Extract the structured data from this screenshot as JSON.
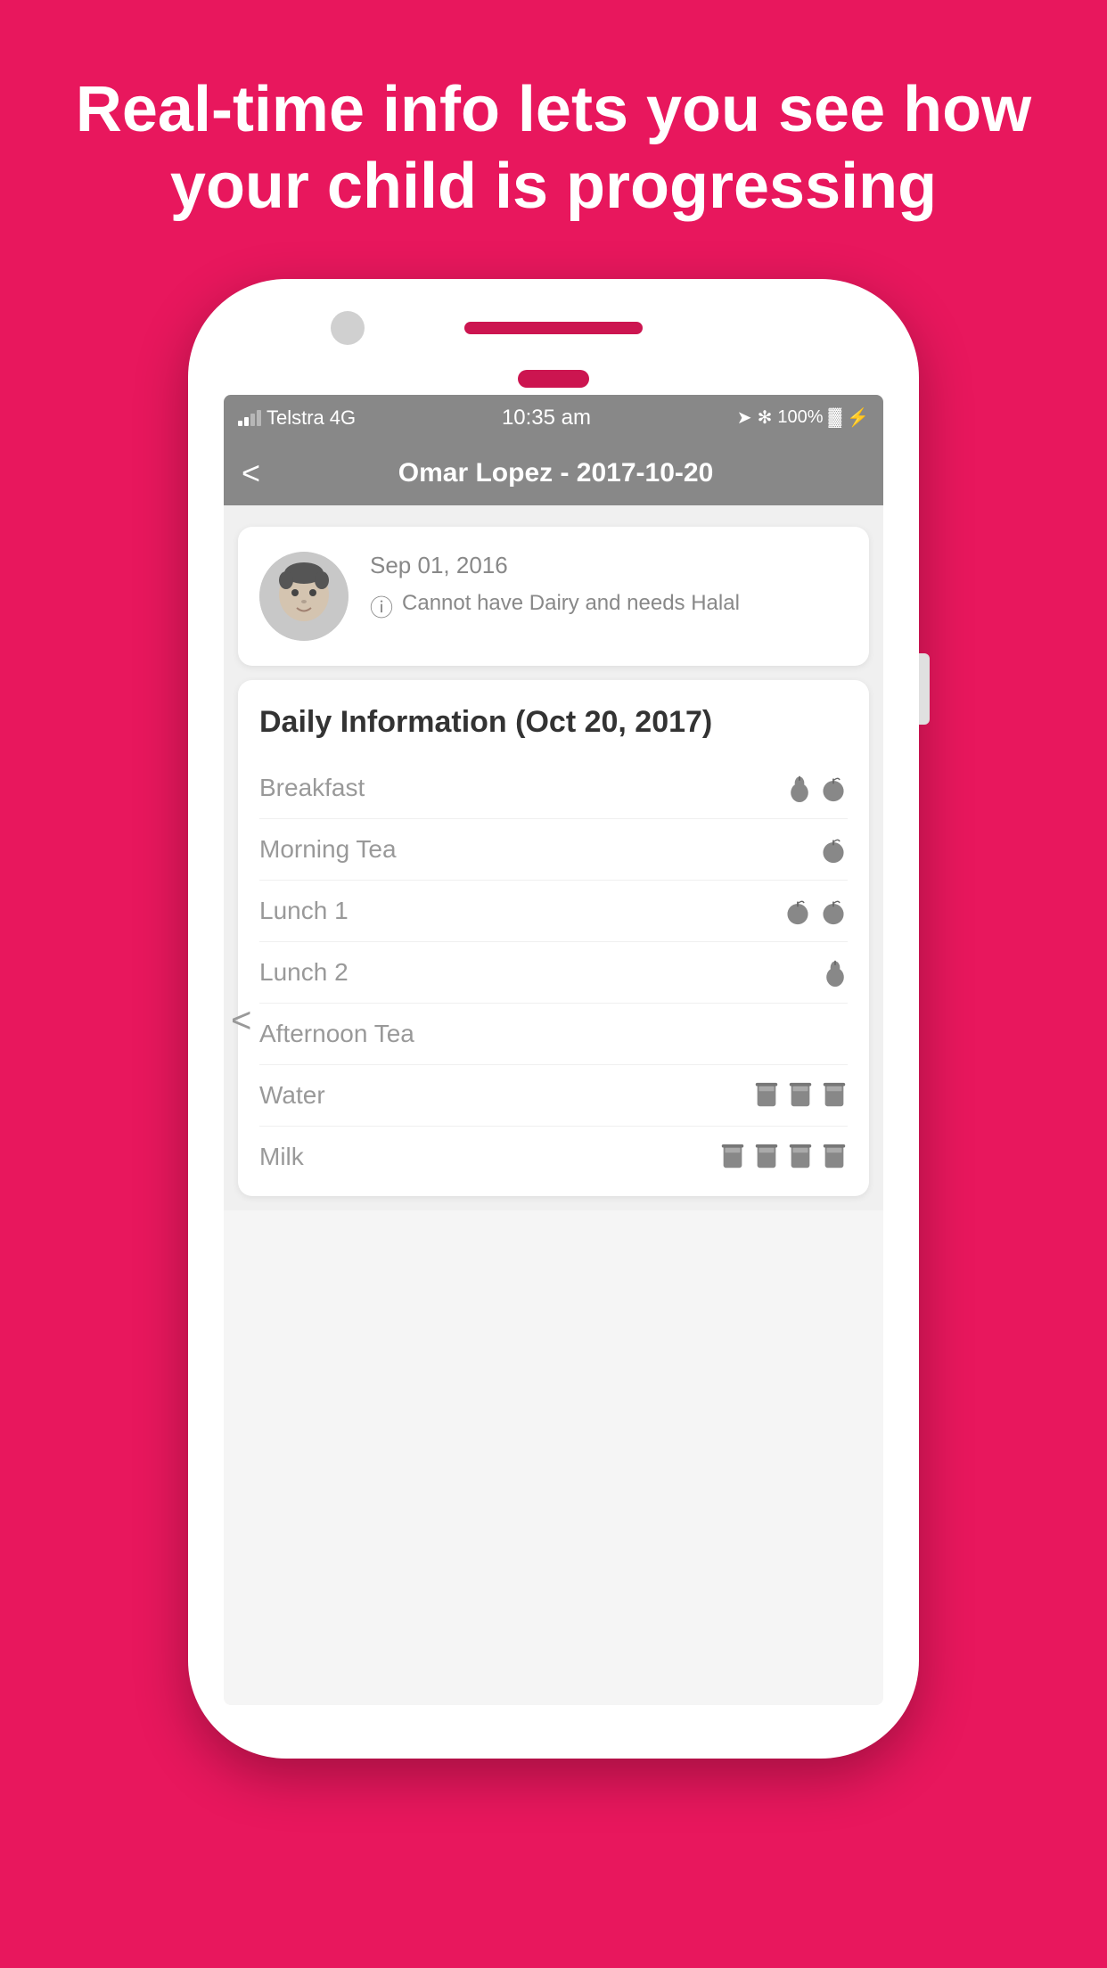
{
  "headline": {
    "line1": "Real-time info lets you see how",
    "line2": "your child is progressing",
    "full": "Real-time info lets you see how your child is progressing"
  },
  "status_bar": {
    "carrier": "Telstra",
    "network": "4G",
    "time": "10:35 am",
    "battery": "100%"
  },
  "header": {
    "back_label": "<",
    "title": "Omar Lopez - 2017-10-20"
  },
  "profile": {
    "date": "Sep 01, 2016",
    "alert_text": "Cannot have Dairy and needs Halal"
  },
  "daily": {
    "title": "Daily Information (Oct 20, 2017)",
    "meals": [
      {
        "name": "Breakfast",
        "icons": [
          "pear",
          "apple"
        ]
      },
      {
        "name": "Morning Tea",
        "icons": [
          "apple"
        ]
      },
      {
        "name": "Lunch 1",
        "icons": [
          "apple",
          "apple"
        ]
      },
      {
        "name": "Lunch 2",
        "icons": [
          "pear"
        ]
      },
      {
        "name": "Afternoon Tea",
        "icons": []
      },
      {
        "name": "Water",
        "icons": [
          "cup",
          "cup",
          "cup"
        ]
      },
      {
        "name": "Milk",
        "icons": [
          "cup",
          "cup",
          "cup",
          "cup"
        ]
      }
    ]
  }
}
